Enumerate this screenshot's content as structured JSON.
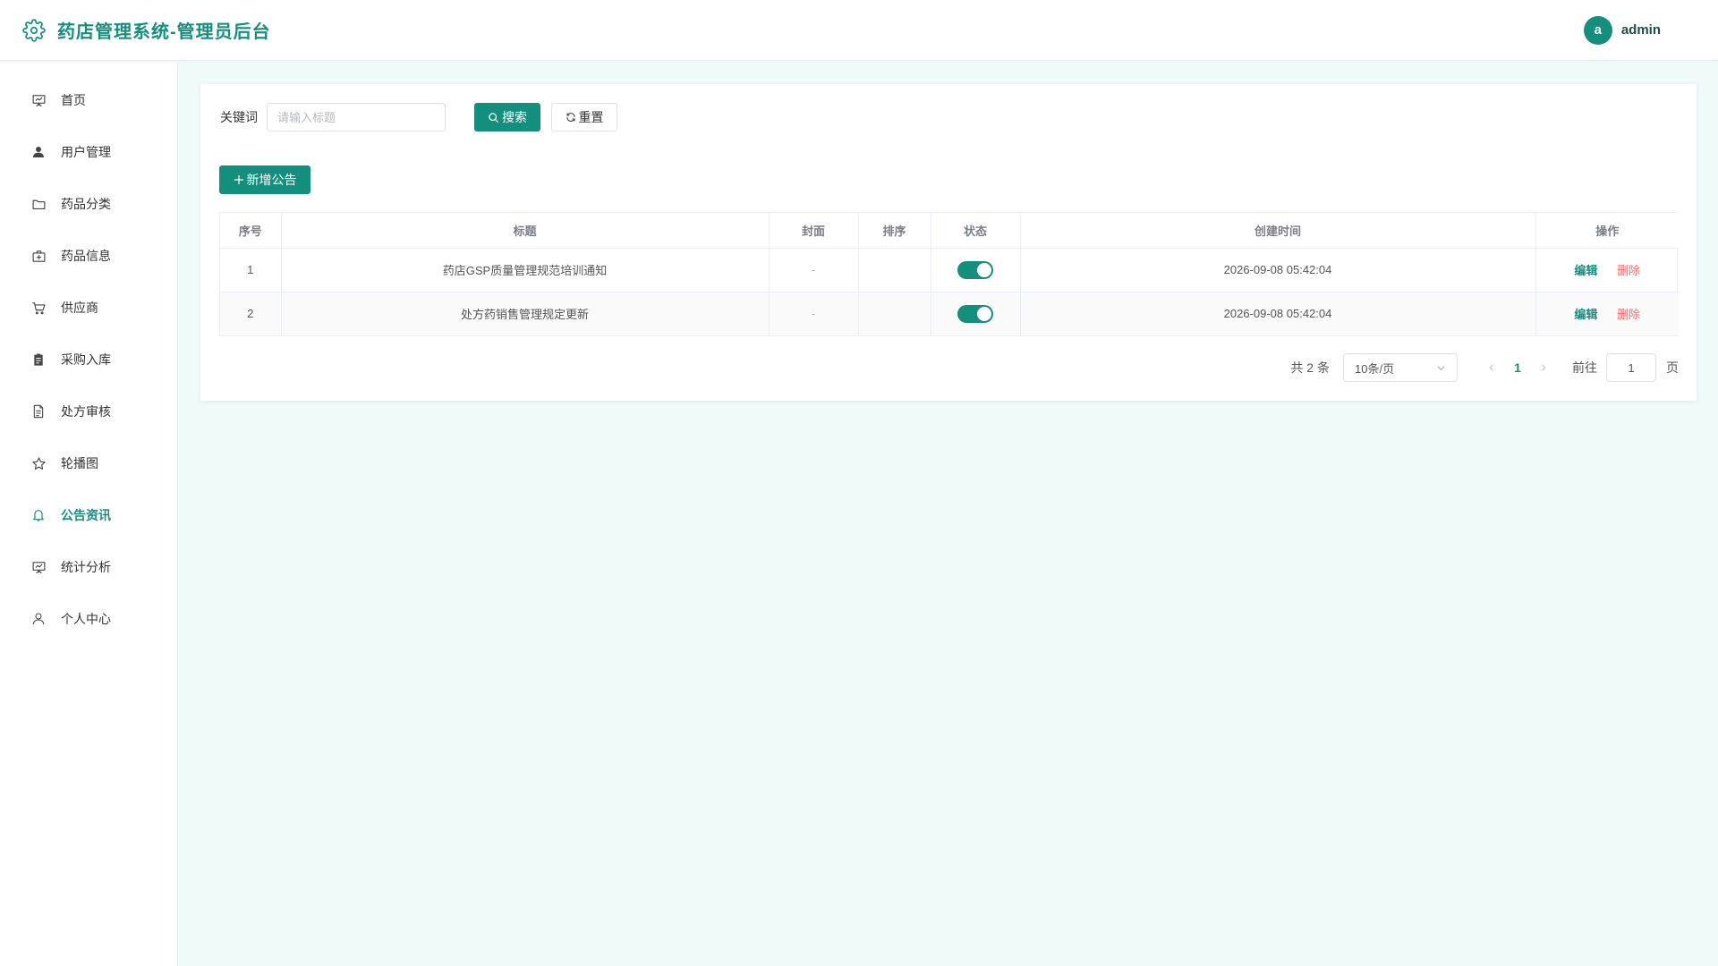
{
  "header": {
    "title": "药店管理系统-管理员后台",
    "logo_icon": "gear-icon",
    "user": {
      "avatar_letter": "a",
      "name": "admin"
    }
  },
  "sidebar": {
    "items": [
      {
        "label": "首页",
        "icon": "presentation-board-icon",
        "active": false
      },
      {
        "label": "用户管理",
        "icon": "user-filled-icon",
        "active": false
      },
      {
        "label": "药品分类",
        "icon": "folder-icon",
        "active": false
      },
      {
        "label": "药品信息",
        "icon": "first-aid-kit-icon",
        "active": false
      },
      {
        "label": "供应商",
        "icon": "shopping-cart-icon",
        "active": false
      },
      {
        "label": "采购入库",
        "icon": "clipboard-icon",
        "active": false
      },
      {
        "label": "处方审核",
        "icon": "document-icon",
        "active": false
      },
      {
        "label": "轮播图",
        "icon": "star-icon",
        "active": false
      },
      {
        "label": "公告资讯",
        "icon": "bell-icon",
        "active": true
      },
      {
        "label": "统计分析",
        "icon": "presentation-board-icon",
        "active": false
      },
      {
        "label": "个人中心",
        "icon": "user-icon",
        "active": false
      }
    ]
  },
  "search": {
    "label": "关键词",
    "placeholder": "请输入标题",
    "search_button": "搜索",
    "reset_button": "重置"
  },
  "toolbar": {
    "add_button": "新增公告"
  },
  "table": {
    "columns": [
      "序号",
      "标题",
      "封面",
      "排序",
      "状态",
      "创建时间",
      "操作"
    ],
    "rows": [
      {
        "index": "1",
        "title": "药店GSP质量管理规范培训通知",
        "cover": "-",
        "sort": "",
        "status": true,
        "created": "2026-09-08 05:42:04"
      },
      {
        "index": "2",
        "title": "处方药销售管理规定更新",
        "cover": "-",
        "sort": "",
        "status": true,
        "created": "2026-09-08 05:42:04"
      }
    ],
    "edit_label": "编辑",
    "delete_label": "删除"
  },
  "pagination": {
    "total_text": "共 2 条",
    "page_size": "10条/页",
    "current_page": "1",
    "goto_label": "前往",
    "goto_value": "1",
    "page_unit": "页"
  },
  "colors": {
    "primary": "#148f7e",
    "danger": "#f56c6c",
    "background": "#f0fbf9"
  }
}
